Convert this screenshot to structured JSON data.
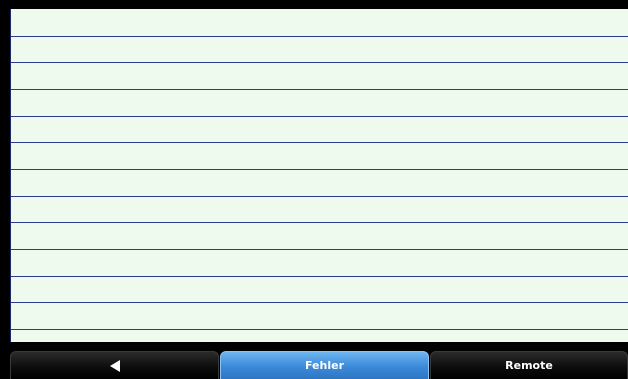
{
  "list": {
    "rows": [
      "",
      "",
      "",
      "",
      "",
      "",
      "",
      "",
      "",
      "",
      "",
      ""
    ]
  },
  "toolbar": {
    "back_icon": "left-triangle-icon",
    "fehler_label": "Fehler",
    "remote_label": "Remote",
    "active_color": "#3a8ad9"
  }
}
